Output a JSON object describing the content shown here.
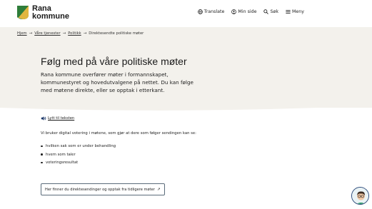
{
  "header": {
    "logo_line1": "Rana",
    "logo_line2": "kommune",
    "nav": [
      {
        "label": "Translate",
        "icon": "globe-icon"
      },
      {
        "label": "Min side",
        "icon": "user-icon"
      },
      {
        "label": "Søk",
        "icon": "search-icon"
      },
      {
        "label": "Meny",
        "icon": "menu-icon"
      }
    ]
  },
  "breadcrumb": {
    "items": [
      "Hjem",
      "Våre tjenester",
      "Politikk"
    ],
    "current": "Direktesendte politiske møter"
  },
  "hero": {
    "title": "Følg med på våre politiske møter",
    "intro": "Rana kommune overfører møter i formannskapet, kommunestyret og hovedutvalgene på nettet. Du kan følge med møtene direkte, eller se opptak i etterkant."
  },
  "content": {
    "listen_label": "Lytt til teksten",
    "paragraph": "Vi bruker digital votering i møtene, som gjør at dere som følger sendingen kan se:",
    "bullets": [
      "hvilken sak som er under behandling",
      "hvem som taler",
      "voteringsresultat"
    ],
    "cta_label": "Her finner du direktesendinger og opptak fra tidligere møter",
    "cta_icon": "external-link-icon"
  },
  "colors": {
    "hero_bg": "#f3f1ec",
    "logo_green": "#2e7d3a",
    "logo_gold": "#e0b640",
    "cta_border": "#5a6b7a"
  }
}
